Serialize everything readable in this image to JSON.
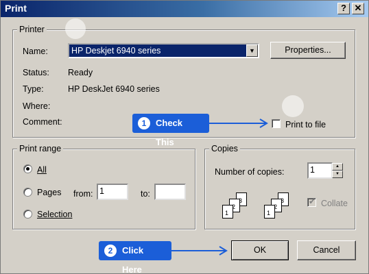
{
  "window": {
    "title": "Print",
    "help_button": "?",
    "close_button": "✕"
  },
  "printer": {
    "group_label": "Printer",
    "name_label": "Name:",
    "name_value": "HP Deskjet 6940 series",
    "properties_button": "Properties...",
    "status_label": "Status:",
    "status_value": "Ready",
    "type_label": "Type:",
    "type_value": "HP DeskJet 6940 series",
    "where_label": "Where:",
    "comment_label": "Comment:",
    "print_to_file_label": "Print to file",
    "print_to_file_checked": false
  },
  "print_range": {
    "group_label": "Print range",
    "options": [
      {
        "label": "All",
        "selected": true
      },
      {
        "label": "Pages",
        "selected": false
      },
      {
        "label": "Selection",
        "selected": false
      }
    ],
    "from_label": "from:",
    "from_value": "1",
    "to_label": "to:",
    "to_value": ""
  },
  "copies": {
    "group_label": "Copies",
    "number_label": "Number of copies:",
    "number_value": "1",
    "collate_label": "Collate",
    "collate_checked": true,
    "collate_enabled": false,
    "collate_pages": [
      "1",
      "2",
      "3"
    ]
  },
  "buttons": {
    "ok": "OK",
    "cancel": "Cancel"
  },
  "callouts": [
    {
      "number": "1",
      "text": "Check This"
    },
    {
      "number": "2",
      "text": "Click Here"
    }
  ],
  "colors": {
    "callout": "#1b5ed8",
    "title_bar": "#0a246a",
    "dialog_bg": "#d4d0c8"
  }
}
